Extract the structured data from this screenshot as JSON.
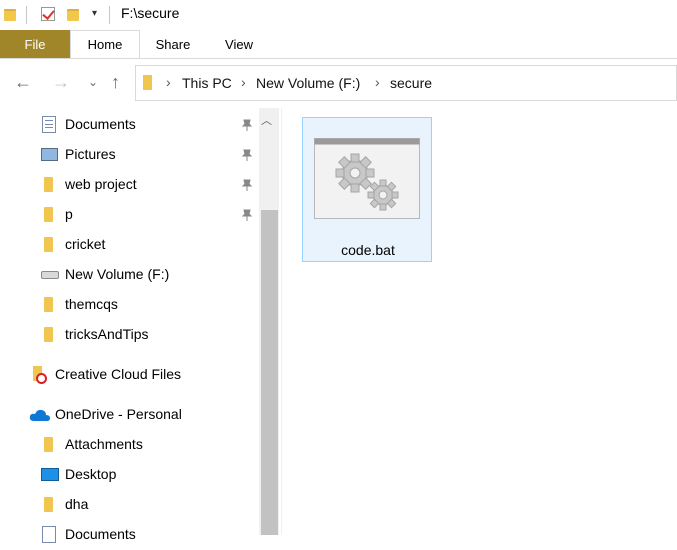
{
  "window": {
    "title": "F:\\secure"
  },
  "ribbon": {
    "tabs": [
      "File",
      "Home",
      "Share",
      "View"
    ]
  },
  "address": {
    "crumbs": [
      "This PC",
      "New Volume (F:)",
      "secure"
    ]
  },
  "nav": {
    "items": [
      {
        "label": "Documents",
        "icon": "documents-icon",
        "pinned": true
      },
      {
        "label": "Pictures",
        "icon": "pictures-icon",
        "pinned": true
      },
      {
        "label": "web project",
        "icon": "folder-icon",
        "pinned": true
      },
      {
        "label": "p",
        "icon": "folder-icon",
        "pinned": true
      },
      {
        "label": "cricket",
        "icon": "folder-icon",
        "pinned": false
      },
      {
        "label": "New Volume (F:)",
        "icon": "drive-icon",
        "pinned": false
      },
      {
        "label": "themcqs",
        "icon": "folder-icon",
        "pinned": false
      },
      {
        "label": "tricksAndTips",
        "icon": "folder-icon",
        "pinned": false
      },
      {
        "label": "Creative Cloud Files",
        "icon": "creative-cloud-icon",
        "pinned": false
      },
      {
        "label": "OneDrive - Personal",
        "icon": "onedrive-icon",
        "pinned": false
      },
      {
        "label": "Attachments",
        "icon": "folder-icon",
        "pinned": false
      },
      {
        "label": "Desktop",
        "icon": "desktop-icon",
        "pinned": false
      },
      {
        "label": "dha",
        "icon": "folder-icon",
        "pinned": false
      },
      {
        "label": "Documents",
        "icon": "documents-icon",
        "pinned": false
      }
    ]
  },
  "files": [
    {
      "name": "code.bat",
      "icon": "batch-file-icon",
      "selected": true
    }
  ],
  "colors": {
    "file_tab": "#a08628",
    "selection_border": "#99d1ff",
    "selection_fill": "#e8f3fd"
  }
}
